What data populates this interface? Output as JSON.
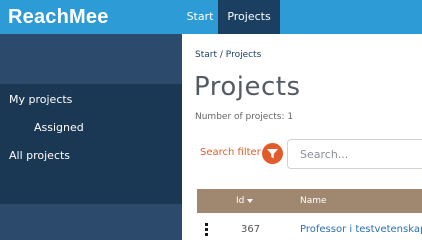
{
  "app": {
    "logo": "ReachMee"
  },
  "topnav": {
    "start": "Start",
    "projects": "Projects"
  },
  "sidebar": {
    "items": [
      {
        "label": "My projects"
      },
      {
        "label": "Assigned"
      },
      {
        "label": "All projects"
      }
    ]
  },
  "breadcrumb": {
    "start": "Start",
    "separator": "/",
    "current": "Projects"
  },
  "page": {
    "title": "Projects",
    "count_text": "Number of projects: 1"
  },
  "filter": {
    "label": "Search filter",
    "icon": "funnel-icon"
  },
  "search": {
    "placeholder": "Search...",
    "value": ""
  },
  "table": {
    "columns": {
      "id": "Id",
      "name": "Name"
    },
    "rows": [
      {
        "id": "367",
        "name": "Professor i testvetenskap"
      }
    ]
  },
  "colors": {
    "topbar": "#2d9bd6",
    "active_nav": "#1a3f61",
    "sidebar": "#2b4a6c",
    "sidebar_menu": "#1a3753",
    "accent": "#e25b2a",
    "table_header": "#a08870",
    "link": "#2a6fb0"
  }
}
